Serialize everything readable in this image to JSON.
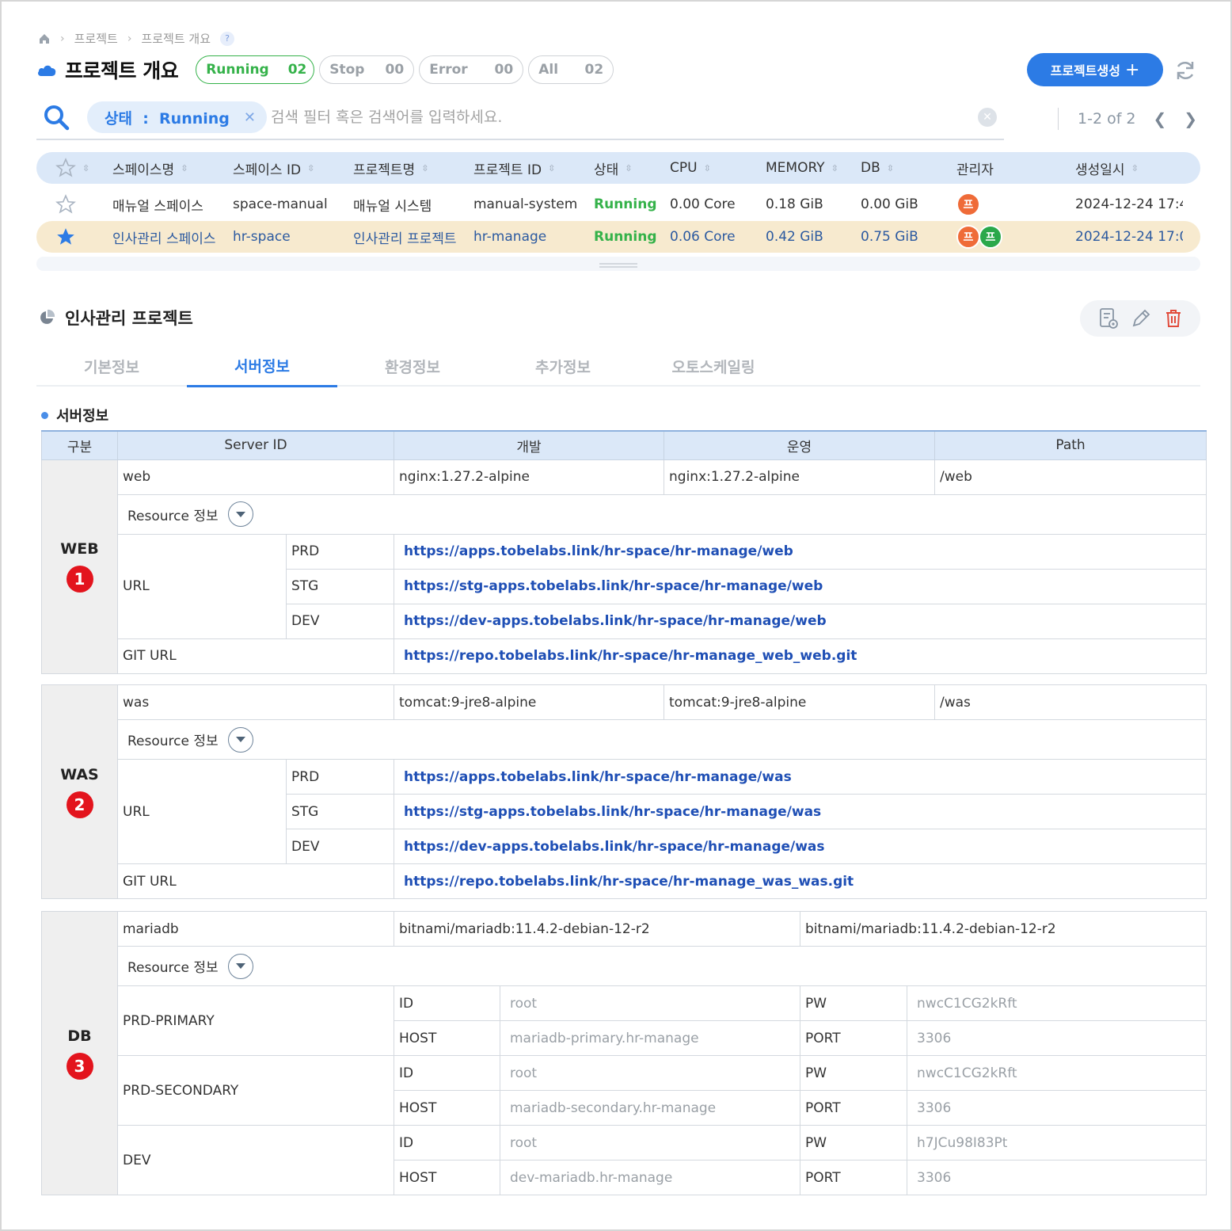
{
  "breadcrumb": {
    "items": [
      "프로젝트",
      "프로젝트 개요"
    ],
    "help": "?"
  },
  "header": {
    "title": "프로젝트 개요",
    "filters": [
      {
        "label": "Running",
        "count": "02",
        "active": true
      },
      {
        "label": "Stop",
        "count": "00",
        "active": false
      },
      {
        "label": "Error",
        "count": "00",
        "active": false
      },
      {
        "label": "All",
        "count": "02",
        "active": false
      }
    ],
    "create_label": "프로젝트생성"
  },
  "search": {
    "chip_key": "상태",
    "chip_sep": ":",
    "chip_value": "Running",
    "placeholder": "검색 필터 혹은 검색어를 입력하세요."
  },
  "pager": {
    "range": "1-2 of 2"
  },
  "projects": {
    "columns": [
      "스페이스명",
      "스페이스 ID",
      "프로젝트명",
      "프로젝트 ID",
      "상태",
      "CPU",
      "MEMORY",
      "DB",
      "관리자",
      "생성일시"
    ],
    "rows": [
      {
        "starred": false,
        "space_name": "매뉴얼 스페이스",
        "space_id": "space-manual",
        "project_name": "매뉴얼 시스템",
        "project_id": "manual-system",
        "status": "Running",
        "cpu": "0.00 Core",
        "memory": "0.18 GiB",
        "db": "0.00 GiB",
        "admins": [
          "프"
        ],
        "created": "2024-12-24 17:4"
      },
      {
        "starred": true,
        "space_name": "인사관리 스페이스",
        "space_id": "hr-space",
        "project_name": "인사관리 프로젝트",
        "project_id": "hr-manage",
        "status": "Running",
        "cpu": "0.06 Core",
        "memory": "0.42 GiB",
        "db": "0.75 GiB",
        "admins": [
          "프",
          "프"
        ],
        "created": "2024-12-24 17:0"
      }
    ]
  },
  "detail": {
    "title": "인사관리 프로젝트",
    "tabs": [
      "기본정보",
      "서버정보",
      "환경정보",
      "추가정보",
      "오토스케일링"
    ],
    "active_tab": "서버정보",
    "section_label": "서버정보"
  },
  "server_table": {
    "headers": {
      "group": "구분",
      "server_id": "Server ID",
      "dev": "개발",
      "ops": "운영",
      "path": "Path"
    },
    "resource_label": "Resource 정보",
    "url_label": "URL",
    "git_label": "GIT URL",
    "web": {
      "group": "WEB",
      "badge": "1",
      "server_id": "web",
      "dev": "nginx:1.27.2-alpine",
      "ops": "nginx:1.27.2-alpine",
      "path": "/web",
      "urls": [
        {
          "env": "PRD",
          "url": "https://apps.tobelabs.link/hr-space/hr-manage/web"
        },
        {
          "env": "STG",
          "url": "https://stg-apps.tobelabs.link/hr-space/hr-manage/web"
        },
        {
          "env": "DEV",
          "url": "https://dev-apps.tobelabs.link/hr-space/hr-manage/web"
        }
      ],
      "git": "https://repo.tobelabs.link/hr-space/hr-manage_web_web.git"
    },
    "was": {
      "group": "WAS",
      "badge": "2",
      "server_id": "was",
      "dev": "tomcat:9-jre8-alpine",
      "ops": "tomcat:9-jre8-alpine",
      "path": "/was",
      "urls": [
        {
          "env": "PRD",
          "url": "https://apps.tobelabs.link/hr-space/hr-manage/was"
        },
        {
          "env": "STG",
          "url": "https://stg-apps.tobelabs.link/hr-space/hr-manage/was"
        },
        {
          "env": "DEV",
          "url": "https://dev-apps.tobelabs.link/hr-space/hr-manage/was"
        }
      ],
      "git": "https://repo.tobelabs.link/hr-space/hr-manage_was_was.git"
    },
    "db": {
      "group": "DB",
      "badge": "3",
      "server_id": "mariadb",
      "dev": "bitnami/mariadb:11.4.2-debian-12-r2",
      "ops": "bitnami/mariadb:11.4.2-debian-12-r2",
      "path": "",
      "labels": {
        "id": "ID",
        "pw": "PW",
        "host": "HOST",
        "port": "PORT"
      },
      "instances": [
        {
          "name": "PRD-PRIMARY",
          "id": "root",
          "pw": "nwcC1CG2kRft",
          "host": "mariadb-primary.hr-manage",
          "port": "3306"
        },
        {
          "name": "PRD-SECONDARY",
          "id": "root",
          "pw": "nwcC1CG2kRft",
          "host": "mariadb-secondary.hr-manage",
          "port": "3306"
        },
        {
          "name": "DEV",
          "id": "root",
          "pw": "h7JCu98I83Pt",
          "host": "dev-mariadb.hr-manage",
          "port": "3306"
        }
      ]
    }
  },
  "colors": {
    "accent": "#2c7be5",
    "running": "#35b24a",
    "badge": "#e3141d",
    "highlight_row": "#f7eacf",
    "header_bg": "#dbe8f8"
  }
}
